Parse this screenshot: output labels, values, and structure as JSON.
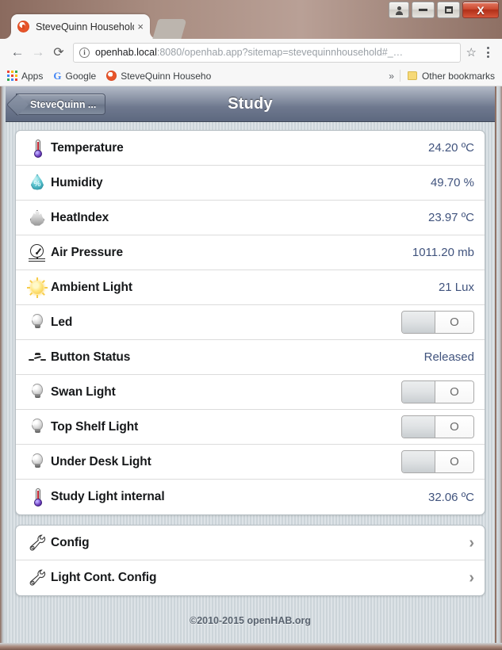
{
  "window": {
    "controls": {
      "user_label": "user-account",
      "minimize_label": "Minimize",
      "maximize_label": "Maximize",
      "close_label": "X"
    }
  },
  "browser": {
    "tab": {
      "title": "SteveQuinn Household",
      "close_glyph": "×",
      "favicon_name": "openhab-favicon"
    },
    "nav": {
      "back_glyph": "←",
      "forward_glyph": "→",
      "reload_glyph": "⟳"
    },
    "omnibox": {
      "info_glyph": "i",
      "url_host": "openhab.local",
      "url_rest": ":8080/openhab.app?sitemap=stevequinnhousehold#_…",
      "star_glyph": "☆"
    },
    "bookmarks": {
      "apps_label": "Apps",
      "google_label": "Google",
      "google_glyph": "G",
      "site_label": "SteveQuinn Househo",
      "overflow_glyph": "»",
      "other_label": "Other bookmarks"
    }
  },
  "openhab": {
    "header": {
      "back_label": "SteveQuinn ...",
      "title": "Study"
    },
    "rows": [
      {
        "icon": "thermometer-icon",
        "label": "Temperature",
        "type": "value",
        "value": "24.20 ºC"
      },
      {
        "icon": "humidity-drop-icon",
        "label": "Humidity",
        "type": "value",
        "value": "49.70 %"
      },
      {
        "icon": "flame-icon",
        "label": "HeatIndex",
        "type": "value",
        "value": "23.97 ºC"
      },
      {
        "icon": "gauge-icon",
        "label": "Air Pressure",
        "type": "value",
        "value": "1011.20 mb"
      },
      {
        "icon": "sun-icon",
        "label": "Ambient Light",
        "type": "value",
        "value": "21 Lux"
      },
      {
        "icon": "lightbulb-icon",
        "label": "Led",
        "type": "toggle",
        "value": "O",
        "state": "off"
      },
      {
        "icon": "switch-icon",
        "label": "Button Status",
        "type": "value",
        "value": "Released"
      },
      {
        "icon": "lightbulb-icon",
        "label": "Swan Light",
        "type": "toggle",
        "value": "O",
        "state": "off"
      },
      {
        "icon": "lightbulb-icon",
        "label": "Top Shelf Light",
        "type": "toggle",
        "value": "O",
        "state": "off"
      },
      {
        "icon": "lightbulb-icon",
        "label": "Under Desk Light",
        "type": "toggle",
        "value": "O",
        "state": "off"
      },
      {
        "icon": "thermometer-icon",
        "label": "Study Light internal",
        "type": "value",
        "value": "32.06 ºC"
      }
    ],
    "links": [
      {
        "icon": "wrench-icon",
        "label": "Config",
        "chevron": "›"
      },
      {
        "icon": "wrench-icon",
        "label": "Light Cont. Config",
        "chevron": "›"
      }
    ],
    "footer": "©2010-2015 openHAB.org"
  },
  "colors": {
    "value_text": "#40537d",
    "header_top": "#b3bac7",
    "header_bottom": "#5d687f",
    "close_button": "#cc4a30"
  }
}
